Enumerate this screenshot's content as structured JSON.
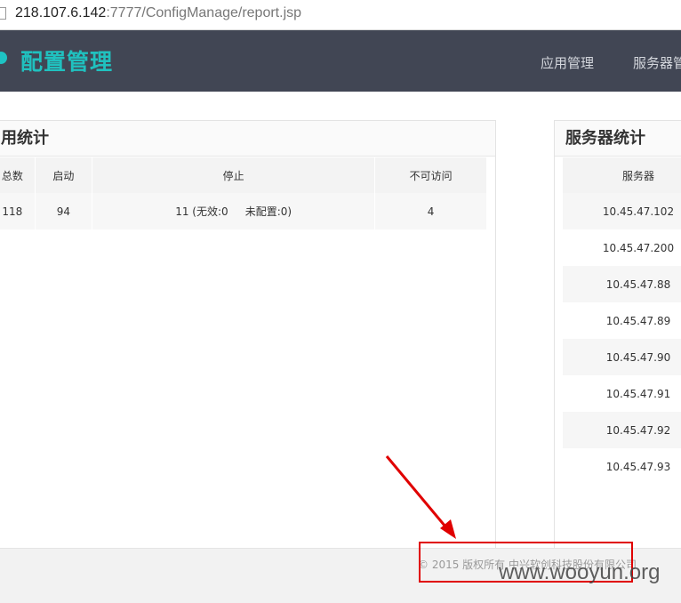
{
  "browser": {
    "url_host": "218.107.6.142",
    "url_rest": ":7777/ConfigManage/report.jsp"
  },
  "navbar": {
    "brand": "配置管理",
    "items": [
      "应用管理",
      "服务器管"
    ]
  },
  "app_panel": {
    "title": "用统计",
    "headers": [
      "总数",
      "启动",
      "停止",
      "不可访问"
    ],
    "rows": [
      [
        "118",
        "94",
        "11 (无效:0     未配置:0)",
        "4"
      ]
    ]
  },
  "server_panel": {
    "title": "服务器统计",
    "header": "服务器",
    "rows": [
      "10.45.47.102",
      "10.45.47.200",
      "10.45.47.88",
      "10.45.47.89",
      "10.45.47.90",
      "10.45.47.91",
      "10.45.47.92",
      "10.45.47.93"
    ]
  },
  "footer": {
    "copyright": "© 2015 版权所有 中兴软创科技股份有限公司"
  },
  "watermark": "www.wooyun.org",
  "colors": {
    "navbar_bg": "#414654",
    "brand": "#20c1bf",
    "highlight": "#e00000"
  }
}
